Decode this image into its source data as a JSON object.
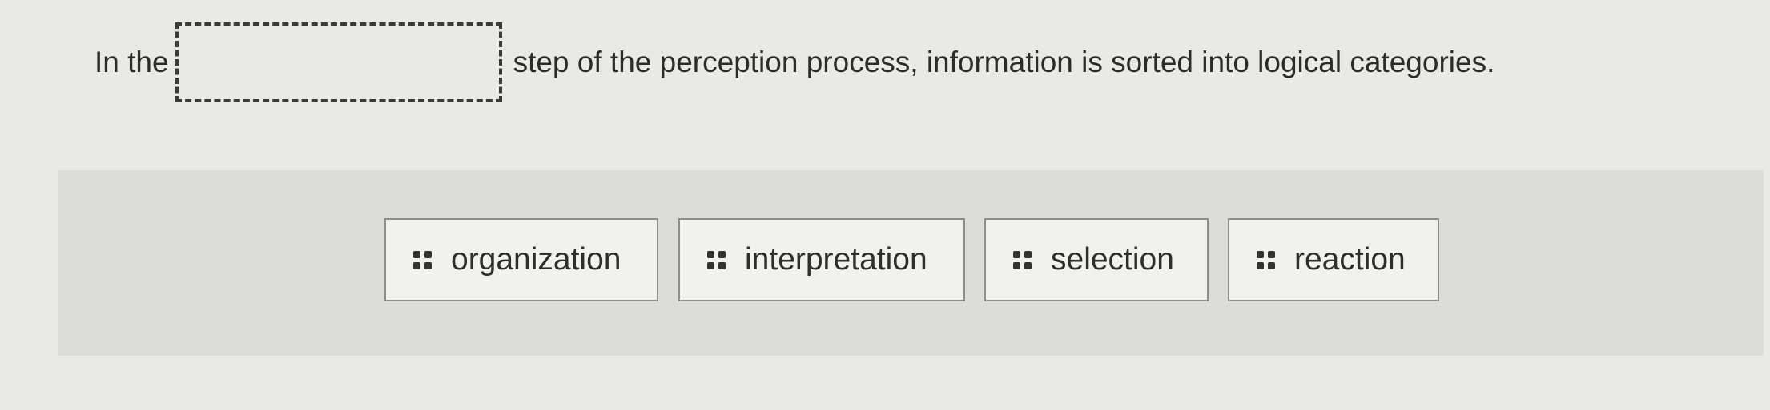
{
  "question": {
    "prefix": "In the",
    "suffix": "step of the perception process, information is sorted into logical categories."
  },
  "choices": [
    {
      "label": "organization"
    },
    {
      "label": "interpretation"
    },
    {
      "label": "selection"
    },
    {
      "label": "reaction"
    }
  ],
  "icons": {
    "drag_handle": "drag-handle-icon"
  }
}
